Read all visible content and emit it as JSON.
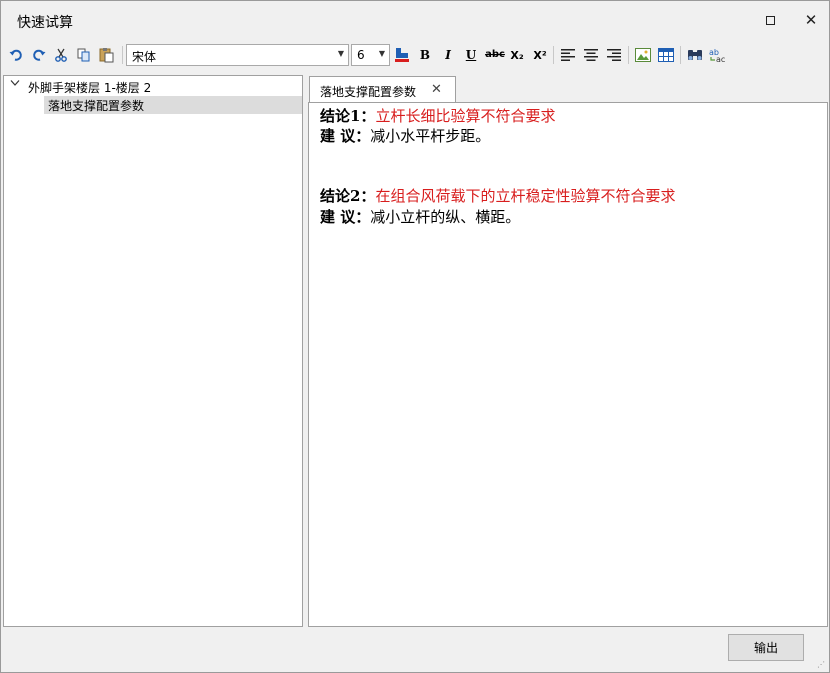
{
  "window": {
    "title": "快速试算",
    "close_glyph": "✕"
  },
  "toolbar": {
    "font_name": "宋体",
    "font_size": "6",
    "bold": "B",
    "italic": "I",
    "underline": "U",
    "strike": "abc",
    "subscript": "X₂",
    "superscript": "X²",
    "accent_color": "#1f5fb4",
    "red_color": "#d81e1e"
  },
  "tree": {
    "parent_label": "外脚手架楼层 1-楼层 2",
    "child_label": "落地支撑配置参数"
  },
  "tab": {
    "label": "落地支撑配置参数",
    "close_glyph": "✕"
  },
  "content": {
    "conclusion1_label": "结论1：",
    "conclusion1_text": "立杆长细比验算不符合要求",
    "suggestion1_label": "建 议：",
    "suggestion1_text": "减小水平杆步距。",
    "conclusion2_label": "结论2：",
    "conclusion2_text": "在组合风荷载下的立杆稳定性验算不符合要求",
    "suggestion2_label": "建 议：",
    "suggestion2_text": "减小立杆的纵、横距。"
  },
  "footer": {
    "output_label": "输出"
  }
}
